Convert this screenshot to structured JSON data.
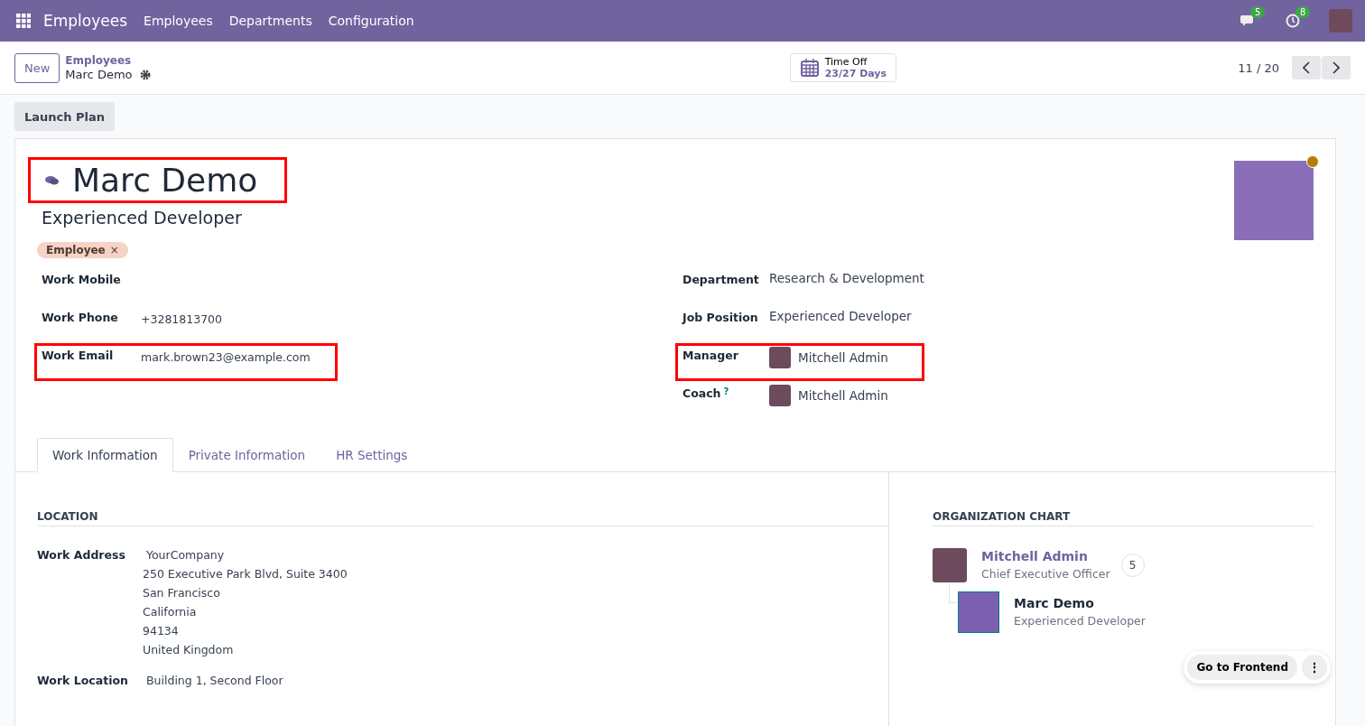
{
  "navbar": {
    "app": "Employees",
    "menu": [
      "Employees",
      "Departments",
      "Configuration"
    ],
    "messages_count": "5",
    "activities_count": "8"
  },
  "control_panel": {
    "new_button": "New",
    "breadcrumb_parent": "Employees",
    "breadcrumb_current": "Marc Demo",
    "time_off_label": "Time Off",
    "time_off_value": "23/27 Days",
    "pager": "11 / 20"
  },
  "action_buttons": [
    "Launch Plan"
  ],
  "employee": {
    "name": "Marc Demo",
    "name_highlighted": true,
    "job_title": "Experienced Developer",
    "tags": [
      {
        "label": "Employee",
        "remove": "×"
      }
    ]
  },
  "left_fields": [
    {
      "label": "Work Mobile",
      "highlighted": false
    },
    {
      "label": "Work Phone",
      "value": "+3281813700",
      "highlighted": false
    },
    {
      "label": "Work Email",
      "value": "mark.brown23@example.com",
      "highlighted": true
    }
  ],
  "right_fields": [
    {
      "label": "Department",
      "value": "Research & Development",
      "kind": "text",
      "highlighted": false
    },
    {
      "label": "Job Position",
      "value": "Experienced Developer",
      "kind": "text",
      "highlighted": false
    },
    {
      "label": "Manager",
      "value": "Mitchell Admin",
      "kind": "person",
      "highlighted": true
    },
    {
      "label": "Coach",
      "value": "Mitchell Admin",
      "kind": "person",
      "highlighted": false,
      "help": "?"
    }
  ],
  "tabs": [
    {
      "label": "Work Information",
      "selected": true
    },
    {
      "label": "Private Information",
      "selected": false
    },
    {
      "label": "HR Settings",
      "selected": false
    }
  ],
  "location": {
    "heading": "LOCATION",
    "rows": [
      {
        "label": "Work Address",
        "lines": [
          "YourCompany",
          "250 Executive Park Blvd, Suite 3400",
          "San Francisco",
          "California",
          "94134",
          "United Kingdom"
        ]
      },
      {
        "label": "Work Location",
        "lines": [
          "Building 1, Second Floor"
        ]
      }
    ]
  },
  "org_chart": {
    "heading": "ORGANIZATION CHART",
    "manager": {
      "name": "Mitchell Admin",
      "title": "Chief Executive Officer",
      "count": "5"
    },
    "employee": {
      "name": "Marc Demo",
      "title": "Experienced Developer"
    }
  },
  "floating": {
    "button": "Go to Frontend",
    "more": "⋮"
  }
}
